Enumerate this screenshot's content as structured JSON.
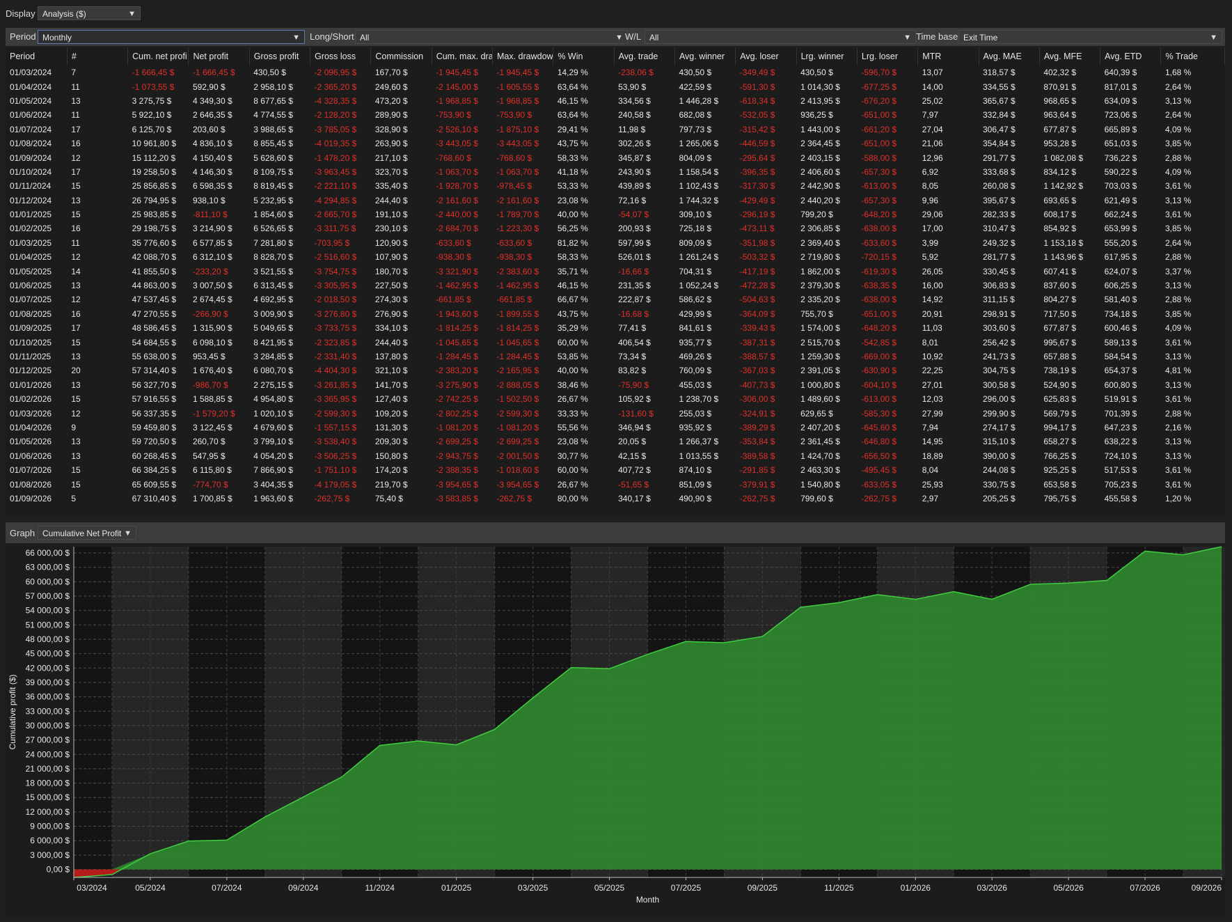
{
  "display": {
    "label": "Display",
    "value": "Analysis ($)"
  },
  "filters": {
    "period": {
      "label": "Period",
      "value": "Monthly"
    },
    "long_short": {
      "label": "Long/Short",
      "value": "All"
    },
    "wl": {
      "label": "W/L",
      "value": "All"
    },
    "time_base": {
      "label": "Time base",
      "value": "Exit Time"
    }
  },
  "table": {
    "columns": [
      "Period",
      "#",
      "Cum. net profi",
      "Net profit",
      "Gross profit",
      "Gross loss",
      "Commission",
      "Cum. max. dra",
      "Max. drawdow",
      "% Win",
      "Avg. trade",
      "Avg. winner",
      "Avg. loser",
      "Lrg. winner",
      "Lrg. loser",
      "MTR",
      "Avg. MAE",
      "Avg. MFE",
      "Avg. ETD",
      "% Trade"
    ],
    "rows": [
      [
        "01/03/2024",
        "7",
        "-1 666,45 $",
        "-1 666,45 $",
        "430,50 $",
        "-2 096,95 $",
        "167,70 $",
        "-1 945,45 $",
        "-1 945,45 $",
        "14,29 %",
        "-238,06 $",
        "430,50 $",
        "-349,49 $",
        "430,50 $",
        "-596,70 $",
        "13,07",
        "318,57 $",
        "402,32 $",
        "640,39 $",
        "1,68 %"
      ],
      [
        "01/04/2024",
        "11",
        "-1 073,55 $",
        "592,90 $",
        "2 958,10 $",
        "-2 365,20 $",
        "249,60 $",
        "-2 145,00 $",
        "-1 605,55 $",
        "63,64 %",
        "53,90 $",
        "422,59 $",
        "-591,30 $",
        "1 014,30 $",
        "-677,25 $",
        "14,00",
        "334,55 $",
        "870,91 $",
        "817,01 $",
        "2,64 %"
      ],
      [
        "01/05/2024",
        "13",
        "3 275,75 $",
        "4 349,30 $",
        "8 677,65 $",
        "-4 328,35 $",
        "473,20 $",
        "-1 968,85 $",
        "-1 968,85 $",
        "46,15 %",
        "334,56 $",
        "1 446,28 $",
        "-618,34 $",
        "2 413,95 $",
        "-676,20 $",
        "25,02",
        "365,67 $",
        "968,65 $",
        "634,09 $",
        "3,13 %"
      ],
      [
        "01/06/2024",
        "11",
        "5 922,10 $",
        "2 646,35 $",
        "4 774,55 $",
        "-2 128,20 $",
        "289,90 $",
        "-753,90 $",
        "-753,90 $",
        "63,64 %",
        "240,58 $",
        "682,08 $",
        "-532,05 $",
        "936,25 $",
        "-651,00 $",
        "7,97",
        "332,84 $",
        "963,64 $",
        "723,06 $",
        "2,64 %"
      ],
      [
        "01/07/2024",
        "17",
        "6 125,70 $",
        "203,60 $",
        "3 988,65 $",
        "-3 785,05 $",
        "328,90 $",
        "-2 526,10 $",
        "-1 875,10 $",
        "29,41 %",
        "11,98 $",
        "797,73 $",
        "-315,42 $",
        "1 443,00 $",
        "-661,20 $",
        "27,04",
        "306,47 $",
        "677,87 $",
        "665,89 $",
        "4,09 %"
      ],
      [
        "01/08/2024",
        "16",
        "10 961,80 $",
        "4 836,10 $",
        "8 855,45 $",
        "-4 019,35 $",
        "263,90 $",
        "-3 443,05 $",
        "-3 443,05 $",
        "43,75 %",
        "302,26 $",
        "1 265,06 $",
        "-446,59 $",
        "2 364,45 $",
        "-651,00 $",
        "21,06",
        "354,84 $",
        "953,28 $",
        "651,03 $",
        "3,85 %"
      ],
      [
        "01/09/2024",
        "12",
        "15 112,20 $",
        "4 150,40 $",
        "5 628,60 $",
        "-1 478,20 $",
        "217,10 $",
        "-768,60 $",
        "-768,60 $",
        "58,33 %",
        "345,87 $",
        "804,09 $",
        "-295,64 $",
        "2 403,15 $",
        "-588,00 $",
        "12,96",
        "291,77 $",
        "1 082,08 $",
        "736,22 $",
        "2,88 %"
      ],
      [
        "01/10/2024",
        "17",
        "19 258,50 $",
        "4 146,30 $",
        "8 109,75 $",
        "-3 963,45 $",
        "323,70 $",
        "-1 063,70 $",
        "-1 063,70 $",
        "41,18 %",
        "243,90 $",
        "1 158,54 $",
        "-396,35 $",
        "2 406,60 $",
        "-657,30 $",
        "6,92",
        "333,68 $",
        "834,12 $",
        "590,22 $",
        "4,09 %"
      ],
      [
        "01/11/2024",
        "15",
        "25 856,85 $",
        "6 598,35 $",
        "8 819,45 $",
        "-2 221,10 $",
        "335,40 $",
        "-1 928,70 $",
        "-978,45 $",
        "53,33 %",
        "439,89 $",
        "1 102,43 $",
        "-317,30 $",
        "2 442,90 $",
        "-613,00 $",
        "8,05",
        "260,08 $",
        "1 142,92 $",
        "703,03 $",
        "3,61 %"
      ],
      [
        "01/12/2024",
        "13",
        "26 794,95 $",
        "938,10 $",
        "5 232,95 $",
        "-4 294,85 $",
        "244,40 $",
        "-2 161,60 $",
        "-2 161,60 $",
        "23,08 %",
        "72,16 $",
        "1 744,32 $",
        "-429,49 $",
        "2 440,20 $",
        "-657,30 $",
        "9,96",
        "395,67 $",
        "693,65 $",
        "621,49 $",
        "3,13 %"
      ],
      [
        "01/01/2025",
        "15",
        "25 983,85 $",
        "-811,10 $",
        "1 854,60 $",
        "-2 665,70 $",
        "191,10 $",
        "-2 440,00 $",
        "-1 789,70 $",
        "40,00 %",
        "-54,07 $",
        "309,10 $",
        "-296,19 $",
        "799,20 $",
        "-648,20 $",
        "29,06",
        "282,33 $",
        "608,17 $",
        "662,24 $",
        "3,61 %"
      ],
      [
        "01/02/2025",
        "16",
        "29 198,75 $",
        "3 214,90 $",
        "6 526,65 $",
        "-3 311,75 $",
        "230,10 $",
        "-2 684,70 $",
        "-1 223,30 $",
        "56,25 %",
        "200,93 $",
        "725,18 $",
        "-473,11 $",
        "2 306,85 $",
        "-638,00 $",
        "17,00",
        "310,47 $",
        "854,92 $",
        "653,99 $",
        "3,85 %"
      ],
      [
        "01/03/2025",
        "11",
        "35 776,60 $",
        "6 577,85 $",
        "7 281,80 $",
        "-703,95 $",
        "120,90 $",
        "-633,60 $",
        "-633,60 $",
        "81,82 %",
        "597,99 $",
        "809,09 $",
        "-351,98 $",
        "2 369,40 $",
        "-633,60 $",
        "3,99",
        "249,32 $",
        "1 153,18 $",
        "555,20 $",
        "2,64 %"
      ],
      [
        "01/04/2025",
        "12",
        "42 088,70 $",
        "6 312,10 $",
        "8 828,70 $",
        "-2 516,60 $",
        "107,90 $",
        "-938,30 $",
        "-938,30 $",
        "58,33 %",
        "526,01 $",
        "1 261,24 $",
        "-503,32 $",
        "2 719,80 $",
        "-720,15 $",
        "5,92",
        "281,77 $",
        "1 143,96 $",
        "617,95 $",
        "2,88 %"
      ],
      [
        "01/05/2025",
        "14",
        "41 855,50 $",
        "-233,20 $",
        "3 521,55 $",
        "-3 754,75 $",
        "180,70 $",
        "-3 321,90 $",
        "-2 383,60 $",
        "35,71 %",
        "-16,66 $",
        "704,31 $",
        "-417,19 $",
        "1 862,00 $",
        "-619,30 $",
        "26,05",
        "330,45 $",
        "607,41 $",
        "624,07 $",
        "3,37 %"
      ],
      [
        "01/06/2025",
        "13",
        "44 863,00 $",
        "3 007,50 $",
        "6 313,45 $",
        "-3 305,95 $",
        "227,50 $",
        "-1 462,95 $",
        "-1 462,95 $",
        "46,15 %",
        "231,35 $",
        "1 052,24 $",
        "-472,28 $",
        "2 379,30 $",
        "-638,35 $",
        "16,00",
        "306,83 $",
        "837,60 $",
        "606,25 $",
        "3,13 %"
      ],
      [
        "01/07/2025",
        "12",
        "47 537,45 $",
        "2 674,45 $",
        "4 692,95 $",
        "-2 018,50 $",
        "274,30 $",
        "-661,85 $",
        "-661,85 $",
        "66,67 %",
        "222,87 $",
        "586,62 $",
        "-504,63 $",
        "2 335,20 $",
        "-638,00 $",
        "14,92",
        "311,15 $",
        "804,27 $",
        "581,40 $",
        "2,88 %"
      ],
      [
        "01/08/2025",
        "16",
        "47 270,55 $",
        "-266,90 $",
        "3 009,90 $",
        "-3 276,80 $",
        "276,90 $",
        "-1 943,60 $",
        "-1 899,55 $",
        "43,75 %",
        "-16,68 $",
        "429,99 $",
        "-364,09 $",
        "755,70 $",
        "-651,00 $",
        "20,91",
        "298,91 $",
        "717,50 $",
        "734,18 $",
        "3,85 %"
      ],
      [
        "01/09/2025",
        "17",
        "48 586,45 $",
        "1 315,90 $",
        "5 049,65 $",
        "-3 733,75 $",
        "334,10 $",
        "-1 814,25 $",
        "-1 814,25 $",
        "35,29 %",
        "77,41 $",
        "841,61 $",
        "-339,43 $",
        "1 574,00 $",
        "-648,20 $",
        "11,03",
        "303,60 $",
        "677,87 $",
        "600,46 $",
        "4,09 %"
      ],
      [
        "01/10/2025",
        "15",
        "54 684,55 $",
        "6 098,10 $",
        "8 421,95 $",
        "-2 323,85 $",
        "244,40 $",
        "-1 045,65 $",
        "-1 045,65 $",
        "60,00 %",
        "406,54 $",
        "935,77 $",
        "-387,31 $",
        "2 515,70 $",
        "-542,85 $",
        "8,01",
        "256,42 $",
        "995,67 $",
        "589,13 $",
        "3,61 %"
      ],
      [
        "01/11/2025",
        "13",
        "55 638,00 $",
        "953,45 $",
        "3 284,85 $",
        "-2 331,40 $",
        "137,80 $",
        "-1 284,45 $",
        "-1 284,45 $",
        "53,85 %",
        "73,34 $",
        "469,26 $",
        "-388,57 $",
        "1 259,30 $",
        "-669,00 $",
        "10,92",
        "241,73 $",
        "657,88 $",
        "584,54 $",
        "3,13 %"
      ],
      [
        "01/12/2025",
        "20",
        "57 314,40 $",
        "1 676,40 $",
        "6 080,70 $",
        "-4 404,30 $",
        "321,10 $",
        "-2 383,20 $",
        "-2 165,95 $",
        "40,00 %",
        "83,82 $",
        "760,09 $",
        "-367,03 $",
        "2 391,05 $",
        "-630,90 $",
        "22,25",
        "304,75 $",
        "738,19 $",
        "654,37 $",
        "4,81 %"
      ],
      [
        "01/01/2026",
        "13",
        "56 327,70 $",
        "-986,70 $",
        "2 275,15 $",
        "-3 261,85 $",
        "141,70 $",
        "-3 275,90 $",
        "-2 888,05 $",
        "38,46 %",
        "-75,90 $",
        "455,03 $",
        "-407,73 $",
        "1 000,80 $",
        "-604,10 $",
        "27,01",
        "300,58 $",
        "524,90 $",
        "600,80 $",
        "3,13 %"
      ],
      [
        "01/02/2026",
        "15",
        "57 916,55 $",
        "1 588,85 $",
        "4 954,80 $",
        "-3 365,95 $",
        "127,40 $",
        "-2 742,25 $",
        "-1 502,50 $",
        "26,67 %",
        "105,92 $",
        "1 238,70 $",
        "-306,00 $",
        "1 489,60 $",
        "-613,00 $",
        "12,03",
        "296,00 $",
        "625,83 $",
        "519,91 $",
        "3,61 %"
      ],
      [
        "01/03/2026",
        "12",
        "56 337,35 $",
        "-1 579,20 $",
        "1 020,10 $",
        "-2 599,30 $",
        "109,20 $",
        "-2 802,25 $",
        "-2 599,30 $",
        "33,33 %",
        "-131,60 $",
        "255,03 $",
        "-324,91 $",
        "629,65 $",
        "-585,30 $",
        "27,99",
        "299,90 $",
        "569,79 $",
        "701,39 $",
        "2,88 %"
      ],
      [
        "01/04/2026",
        "9",
        "59 459,80 $",
        "3 122,45 $",
        "4 679,60 $",
        "-1 557,15 $",
        "131,30 $",
        "-1 081,20 $",
        "-1 081,20 $",
        "55,56 %",
        "346,94 $",
        "935,92 $",
        "-389,29 $",
        "2 407,20 $",
        "-645,60 $",
        "7,94",
        "274,17 $",
        "994,17 $",
        "647,23 $",
        "2,16 %"
      ],
      [
        "01/05/2026",
        "13",
        "59 720,50 $",
        "260,70 $",
        "3 799,10 $",
        "-3 538,40 $",
        "209,30 $",
        "-2 699,25 $",
        "-2 699,25 $",
        "23,08 %",
        "20,05 $",
        "1 266,37 $",
        "-353,84 $",
        "2 361,45 $",
        "-646,80 $",
        "14,95",
        "315,10 $",
        "658,27 $",
        "638,22 $",
        "3,13 %"
      ],
      [
        "01/06/2026",
        "13",
        "60 268,45 $",
        "547,95 $",
        "4 054,20 $",
        "-3 506,25 $",
        "150,80 $",
        "-2 943,75 $",
        "-2 001,50 $",
        "30,77 %",
        "42,15 $",
        "1 013,55 $",
        "-389,58 $",
        "1 424,70 $",
        "-656,50 $",
        "18,89",
        "390,00 $",
        "766,25 $",
        "724,10 $",
        "3,13 %"
      ],
      [
        "01/07/2026",
        "15",
        "66 384,25 $",
        "6 115,80 $",
        "7 866,90 $",
        "-1 751,10 $",
        "174,20 $",
        "-2 388,35 $",
        "-1 018,60 $",
        "60,00 %",
        "407,72 $",
        "874,10 $",
        "-291,85 $",
        "2 463,30 $",
        "-495,45 $",
        "8,04",
        "244,08 $",
        "925,25 $",
        "517,53 $",
        "3,61 %"
      ],
      [
        "01/08/2026",
        "15",
        "65 609,55 $",
        "-774,70 $",
        "3 404,35 $",
        "-4 179,05 $",
        "219,70 $",
        "-3 954,65 $",
        "-3 954,65 $",
        "26,67 %",
        "-51,65 $",
        "851,09 $",
        "-379,91 $",
        "1 540,80 $",
        "-633,05 $",
        "25,93",
        "330,75 $",
        "653,58 $",
        "705,23 $",
        "3,61 %"
      ],
      [
        "01/09/2026",
        "5",
        "67 310,40 $",
        "1 700,85 $",
        "1 963,60 $",
        "-262,75 $",
        "75,40 $",
        "-3 583,85 $",
        "-262,75 $",
        "80,00 %",
        "340,17 $",
        "490,90 $",
        "-262,75 $",
        "799,60 $",
        "-262,75 $",
        "2,97",
        "205,25 $",
        "795,75 $",
        "455,58 $",
        "1,20 %"
      ]
    ]
  },
  "graph": {
    "label": "Graph",
    "value": "Cumulative Net Profit"
  },
  "colors": {
    "negative": "#e0302a",
    "area_fill": "#2f8a2f",
    "area_line": "#3fcf3f",
    "neg_fill": "#b51c1c"
  },
  "chart_data": {
    "type": "area",
    "xlabel": "Month",
    "ylabel": "Cumulative profit ($)",
    "x": [
      "03/2024",
      "04/2024",
      "05/2024",
      "06/2024",
      "07/2024",
      "08/2024",
      "09/2024",
      "10/2024",
      "11/2024",
      "12/2024",
      "01/2025",
      "02/2025",
      "03/2025",
      "04/2025",
      "05/2025",
      "06/2025",
      "07/2025",
      "08/2025",
      "09/2025",
      "10/2025",
      "11/2025",
      "12/2025",
      "01/2026",
      "02/2026",
      "03/2026",
      "04/2026",
      "05/2026",
      "06/2026",
      "07/2026",
      "08/2026",
      "09/2026"
    ],
    "values": [
      -1666.45,
      -1073.55,
      3275.75,
      5922.1,
      6125.7,
      10961.8,
      15112.2,
      19258.5,
      25856.85,
      26794.95,
      25983.85,
      29198.75,
      35776.6,
      42088.7,
      41855.5,
      44863.0,
      47537.45,
      47270.55,
      48586.45,
      54684.55,
      55638.0,
      57314.4,
      56327.7,
      57916.55,
      56337.35,
      59459.8,
      59720.5,
      60268.45,
      66384.25,
      65609.55,
      67310.4
    ],
    "xtick_labels": [
      "03/2024",
      "05/2024",
      "07/2024",
      "09/2024",
      "11/2024",
      "01/2025",
      "03/2025",
      "05/2025",
      "07/2025",
      "09/2025",
      "11/2025",
      "01/2026",
      "03/2026",
      "05/2026",
      "07/2026",
      "09/2026"
    ],
    "ytick_labels": [
      "0,00 $",
      "3 000,00 $",
      "6 000,00 $",
      "9 000,00 $",
      "12 000,00 $",
      "15 000,00 $",
      "18 000,00 $",
      "21 000,00 $",
      "24 000,00 $",
      "27 000,00 $",
      "30 000,00 $",
      "33 000,00 $",
      "36 000,00 $",
      "39 000,00 $",
      "42 000,00 $",
      "45 000,00 $",
      "48 000,00 $",
      "51 000,00 $",
      "54 000,00 $",
      "57 000,00 $",
      "60 000,00 $",
      "63 000,00 $",
      "66 000,00 $"
    ],
    "ylim": [
      -1666.45,
      67310.4
    ],
    "grid": true
  }
}
